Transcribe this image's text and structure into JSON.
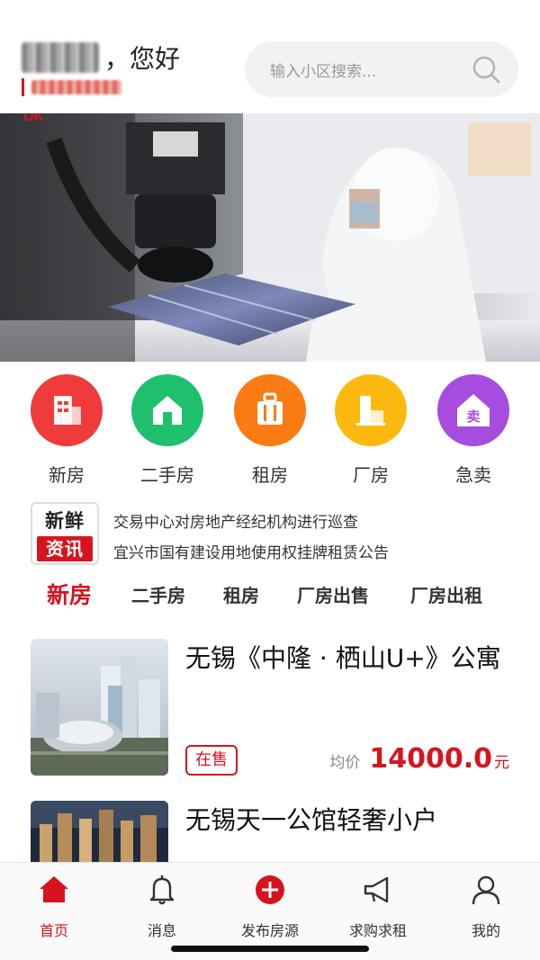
{
  "header": {
    "greeting_suffix": "，您好",
    "search_placeholder": "输入小区搜索..."
  },
  "colors": {
    "brand_red": "#d7141e",
    "cat_new": "#ef3b3b",
    "cat_second": "#1ec06e",
    "cat_rent": "#fa7b12",
    "cat_factory": "#fdb90f",
    "cat_urgent": "#a64cde"
  },
  "categories": [
    {
      "label": "新房",
      "icon": "building-icon"
    },
    {
      "label": "二手房",
      "icon": "house-icon"
    },
    {
      "label": "租房",
      "icon": "luggage-icon"
    },
    {
      "label": "厂房",
      "icon": "factory-icon"
    },
    {
      "label": "急卖",
      "icon": "sell-house-icon"
    }
  ],
  "news": {
    "badge_top": "新鲜",
    "badge_bottom": "资讯",
    "items": [
      "交易中心对房地产经纪机构进行巡查",
      "宜兴市国有建设用地使用权挂牌租赁公告"
    ]
  },
  "tabs": [
    {
      "label": "新房",
      "active": true
    },
    {
      "label": "二手房",
      "active": false
    },
    {
      "label": "租房",
      "active": false
    },
    {
      "label": "厂房出售",
      "active": false
    },
    {
      "label": "厂房出租",
      "active": false
    }
  ],
  "listings": [
    {
      "title": "无锡《中隆 · 栖山U+》公寓",
      "status": "在售",
      "price_label": "均价",
      "price_value": "14000.0",
      "price_unit": "元"
    },
    {
      "title": "无锡天一公馆轻奢小户"
    }
  ],
  "bottom_nav": [
    {
      "label": "首页",
      "icon": "home-icon",
      "active": true
    },
    {
      "label": "消息",
      "icon": "bell-icon",
      "active": false
    },
    {
      "label": "发布房源",
      "icon": "plus-circle-icon",
      "active": false
    },
    {
      "label": "求购求租",
      "icon": "megaphone-icon",
      "active": false
    },
    {
      "label": "我的",
      "icon": "user-icon",
      "active": false
    }
  ]
}
